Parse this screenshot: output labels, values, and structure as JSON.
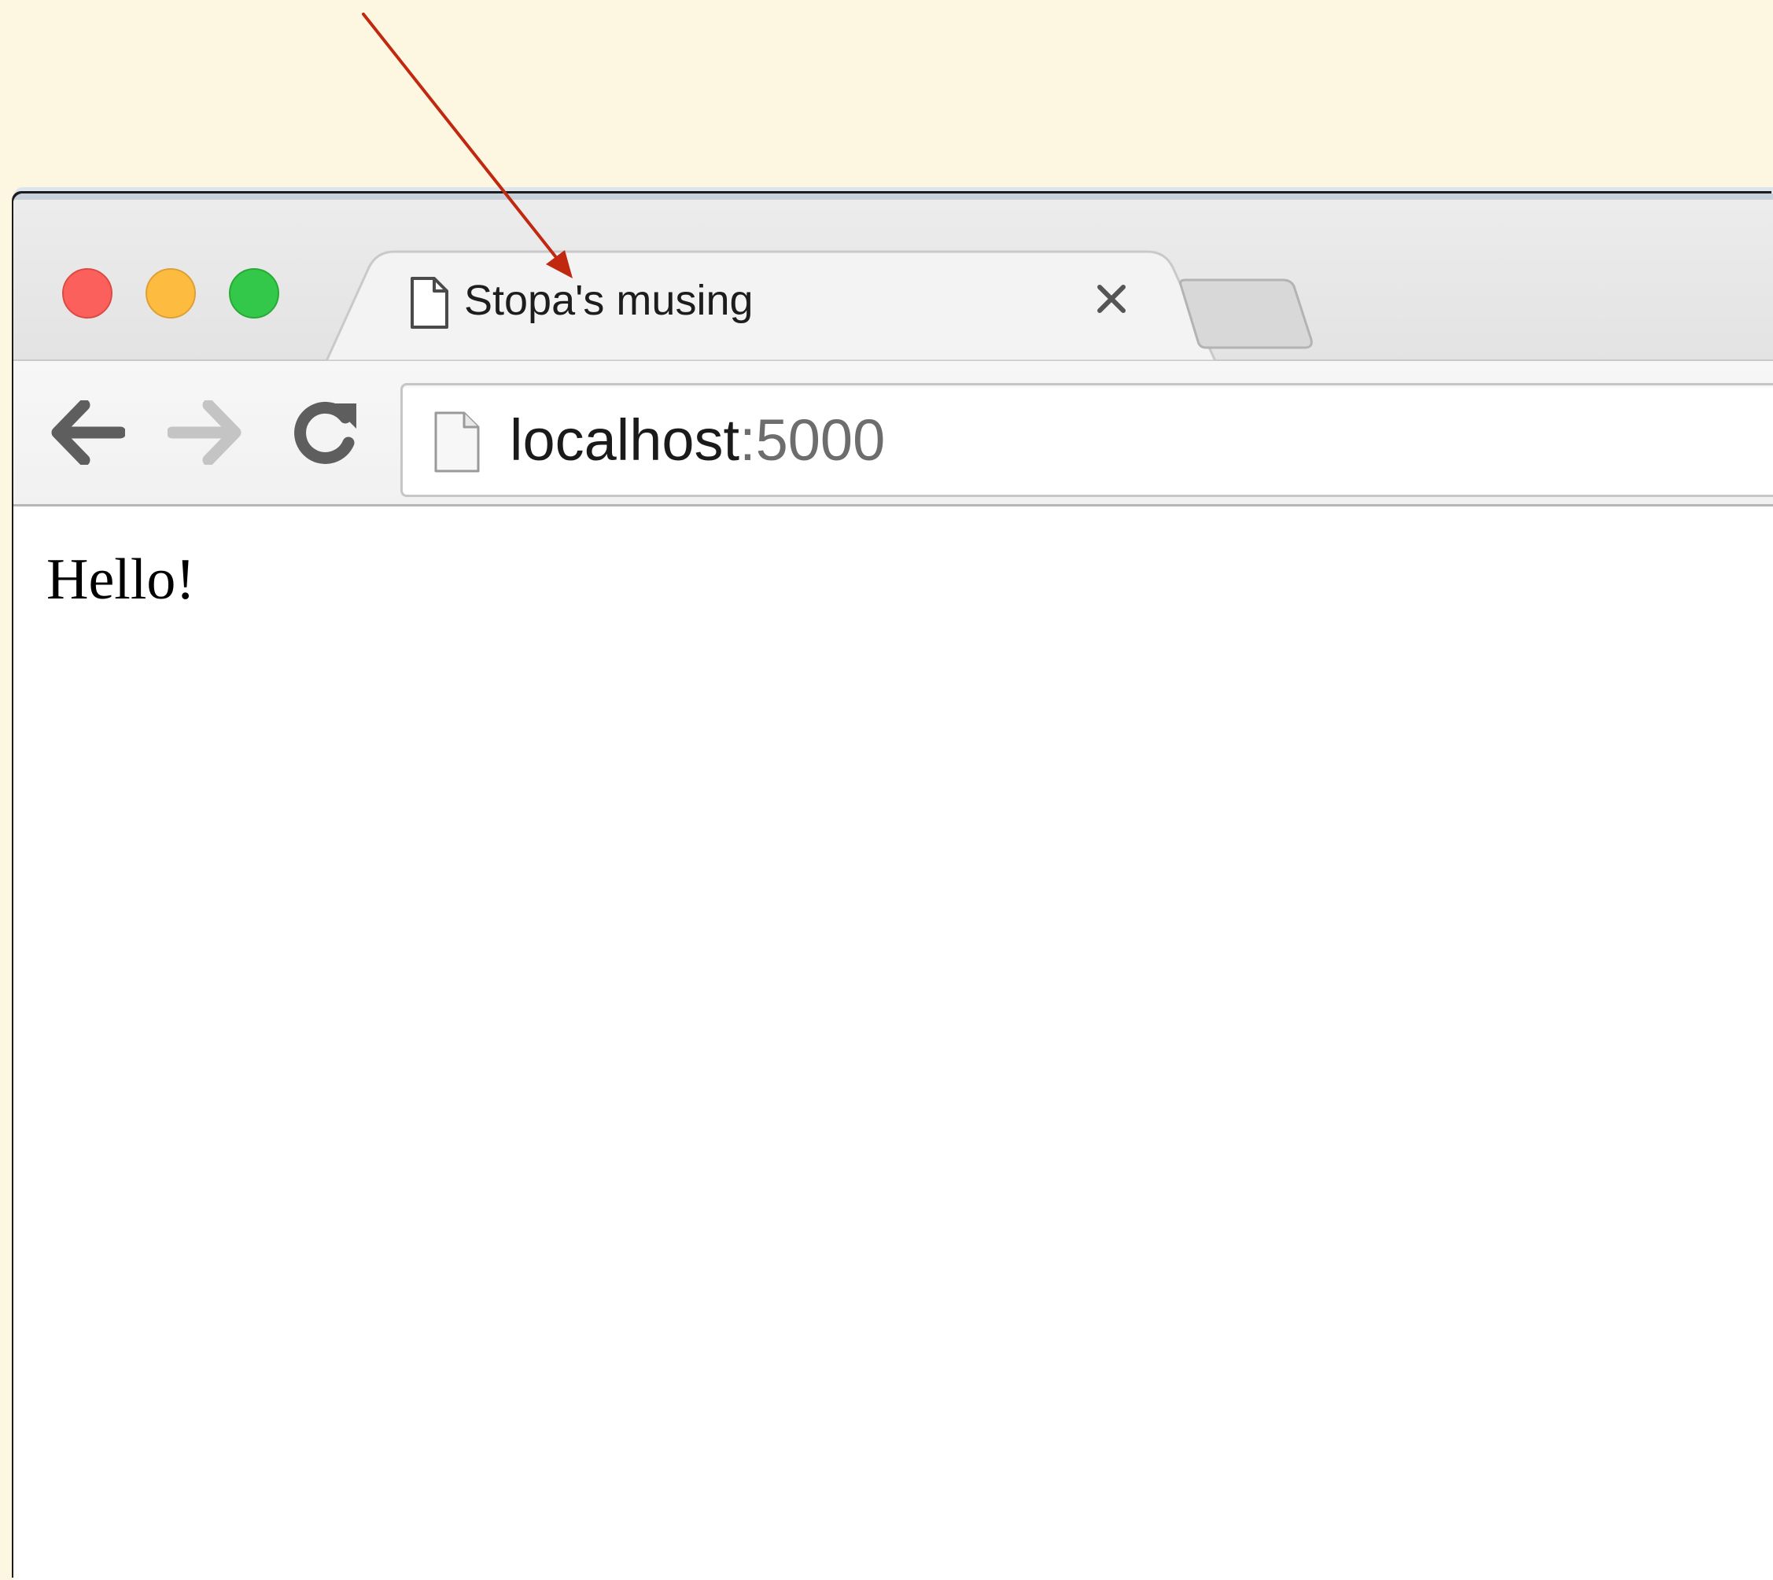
{
  "window": {
    "controls": {
      "close_color": "#fc605c",
      "minimize_color": "#fdbc40",
      "zoom_color": "#34c84a"
    }
  },
  "tabs": [
    {
      "title": "Stopa's musing",
      "icon": "document-icon",
      "close_icon": "close-icon",
      "active": true
    }
  ],
  "new_tab": {
    "icon": "new-tab-icon"
  },
  "toolbar": {
    "back_icon": "back-arrow-icon",
    "forward_icon": "forward-arrow-icon",
    "reload_icon": "reload-icon"
  },
  "address_bar": {
    "icon": "page-icon",
    "host": "localhost",
    "port": ":5000"
  },
  "page": {
    "body_text": "Hello!"
  },
  "annotation": {
    "arrow_color": "#c0280f"
  }
}
